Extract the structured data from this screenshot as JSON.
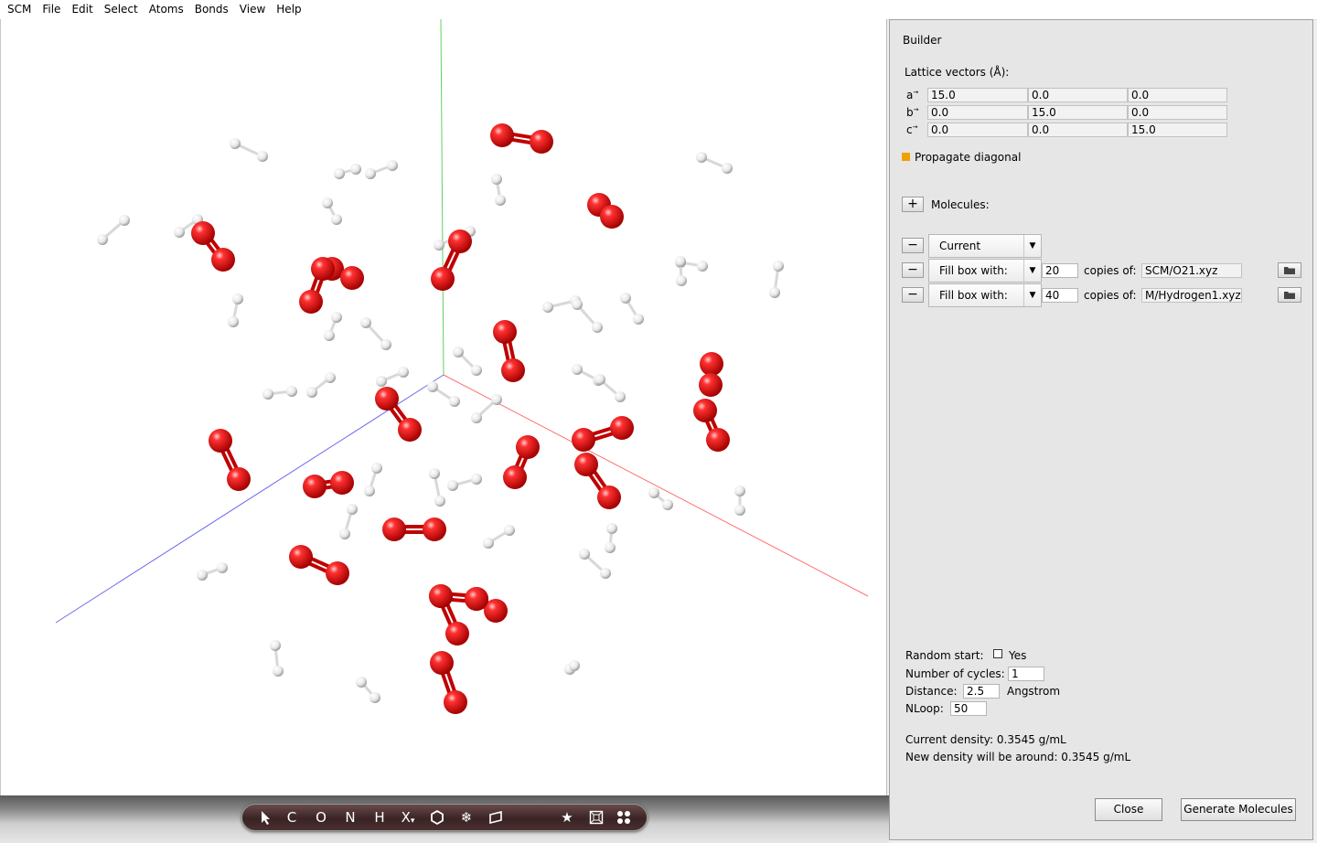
{
  "menu": [
    "SCM",
    "File",
    "Edit",
    "Select",
    "Atoms",
    "Bonds",
    "View",
    "Help"
  ],
  "toolbar": {
    "tools": [
      {
        "icon": "select-arrow-icon",
        "label": ""
      },
      {
        "icon": "carbon-tool",
        "label": "C"
      },
      {
        "icon": "oxygen-tool",
        "label": "O"
      },
      {
        "icon": "nitrogen-tool",
        "label": "N"
      },
      {
        "icon": "hydrogen-tool",
        "label": "H"
      },
      {
        "icon": "other-element-tool",
        "label": "X"
      },
      {
        "icon": "ring-icon",
        "label": ""
      },
      {
        "icon": "snowflake-icon",
        "label": ""
      },
      {
        "icon": "plane-icon",
        "label": ""
      },
      {
        "icon": "star-icon",
        "label": ""
      },
      {
        "icon": "crystal-box-icon",
        "label": ""
      },
      {
        "icon": "molecules-icon",
        "label": ""
      }
    ]
  },
  "builder": {
    "title": "Builder",
    "lattice_label": "Lattice vectors (Å):",
    "vectors": [
      {
        "name": "a",
        "values": [
          "15.0",
          "0.0",
          "0.0"
        ]
      },
      {
        "name": "b",
        "values": [
          "0.0",
          "15.0",
          "0.0"
        ]
      },
      {
        "name": "c",
        "values": [
          "0.0",
          "0.0",
          "15.0"
        ]
      }
    ],
    "propagate_label": "Propagate diagonal",
    "propagate_color": "#f0a000",
    "add_button": "+",
    "molecules_label": "Molecules:",
    "rows": [
      {
        "remove": "−",
        "mode": "Current",
        "has_count": false
      },
      {
        "remove": "−",
        "mode": "Fill box with:",
        "count": "20",
        "copies_label": "copies of:",
        "file": "SCM/O21.xyz"
      },
      {
        "remove": "−",
        "mode": "Fill box with:",
        "count": "40",
        "copies_label": "copies of:",
        "file": "M/Hydrogen1.xyz"
      }
    ],
    "random_start_label": "Random start:",
    "random_start_option": "Yes",
    "random_start_checked": false,
    "cycles_label": "Number of cycles:",
    "cycles_value": "1",
    "distance_label": "Distance:",
    "distance_value": "2.5",
    "distance_unit": "Angstrom",
    "nloop_label": "NLoop:",
    "nloop_value": "50",
    "current_density": "Current density: 0.3545 g/mL",
    "new_density": "New density will be around: 0.3545 g/mL",
    "close_button": "Close",
    "generate_button": "Generate Molecules"
  },
  "scene": {
    "oxygen_color": "#e01010",
    "hydrogen_color": "#f2f2f2",
    "axis_colors": {
      "x": "#ff7070",
      "y": "#60d060",
      "z": "#6a6aee"
    }
  }
}
